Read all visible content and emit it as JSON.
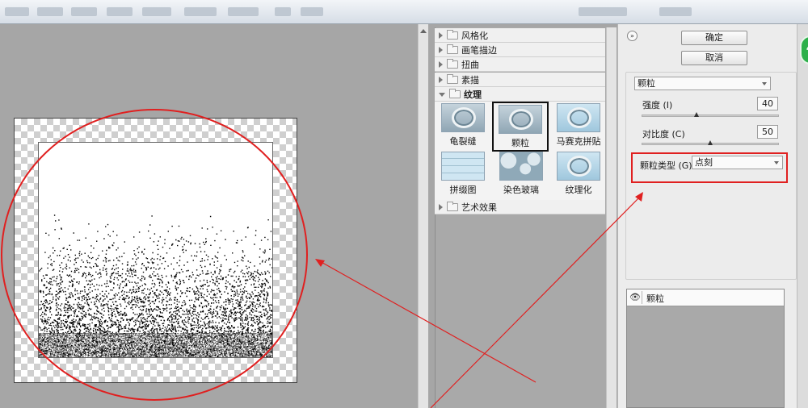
{
  "categories": [
    {
      "label": "风格化",
      "open": false
    },
    {
      "label": "画笔描边",
      "open": false
    },
    {
      "label": "扭曲",
      "open": false
    },
    {
      "label": "素描",
      "open": false
    },
    {
      "label": "纹理",
      "open": true
    },
    {
      "label": "艺术效果",
      "open": false
    }
  ],
  "thumbnails": [
    {
      "label": "龟裂缝",
      "selected": false
    },
    {
      "label": "颗粒",
      "selected": true
    },
    {
      "label": "马赛克拼贴",
      "selected": false
    },
    {
      "label": "拼缀图",
      "selected": false
    },
    {
      "label": "染色玻璃",
      "selected": false
    },
    {
      "label": "纹理化",
      "selected": false
    }
  ],
  "buttons": {
    "ok": "确定",
    "cancel": "取消",
    "collapse": "»"
  },
  "settings": {
    "filter_select": "颗粒",
    "intensity_label": "强度 (I)",
    "intensity_value": "40",
    "intensity_fraction": 0.4,
    "contrast_label": "对比度 (C)",
    "contrast_value": "50",
    "contrast_fraction": 0.5,
    "grain_type_label": "颗粒类型 (G):",
    "grain_type_value": "点刻"
  },
  "layers": [
    {
      "name": "颗粒",
      "visible": true
    }
  ],
  "colors": {
    "annotation": "#e02020",
    "badge": "#2db04a"
  }
}
